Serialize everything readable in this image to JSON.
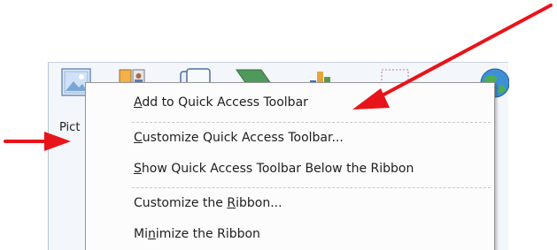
{
  "ribbon": {
    "picture_label": "Pict",
    "icons": [
      "picture-icon",
      "clip-art-icon",
      "shapes-icon",
      "smartart-icon",
      "chart-icon",
      "screenshot-icon",
      "globe-icon"
    ]
  },
  "context_menu": {
    "items": [
      {
        "id": "add-to-quick-access-toolbar",
        "prefix": "",
        "mnemonic": "A",
        "suffix": "dd to Quick Access Toolbar"
      },
      {
        "id": "customize-quick-access-toolbar",
        "prefix": "",
        "mnemonic": "C",
        "suffix": "ustomize Quick Access Toolbar..."
      },
      {
        "id": "show-quick-access-toolbar-below-ribbon",
        "prefix": "",
        "mnemonic": "S",
        "suffix": "how Quick Access Toolbar Below the Ribbon"
      },
      {
        "id": "customize-the-ribbon",
        "prefix": "Customize the ",
        "mnemonic": "R",
        "suffix": "ibbon..."
      },
      {
        "id": "minimize-the-ribbon",
        "prefix": "Mi",
        "mnemonic": "n",
        "suffix": "imize the Ribbon"
      }
    ]
  },
  "annotations": {
    "arrow_color": "#e8141a"
  }
}
